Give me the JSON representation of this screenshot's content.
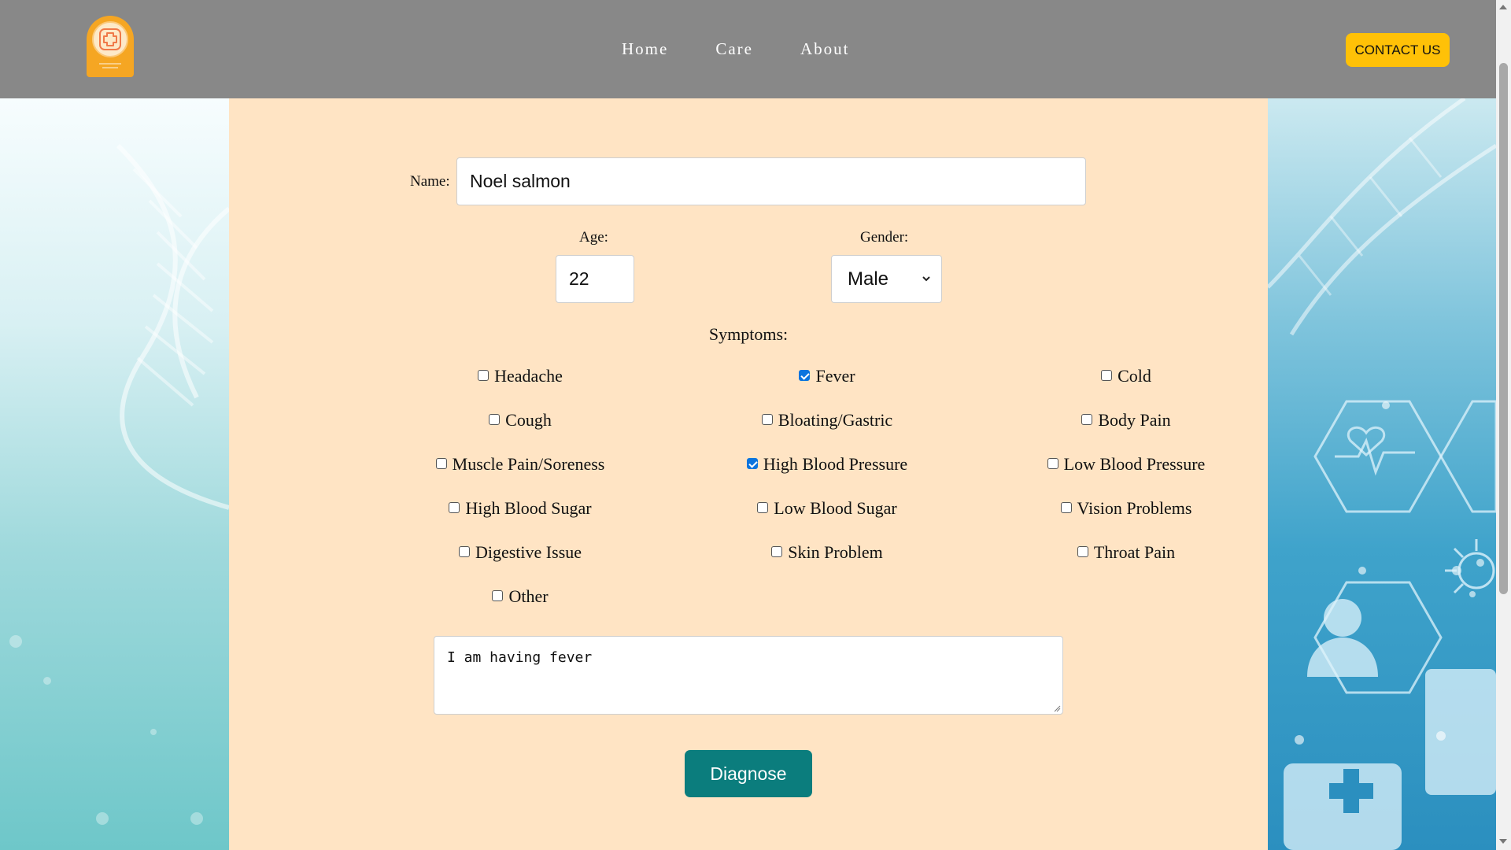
{
  "nav": {
    "links": [
      "Home",
      "Care",
      "About"
    ],
    "contact_label": "CONTACT US"
  },
  "form": {
    "name_label": "Name:",
    "name_value": "Noel salmon",
    "age_label": "Age:",
    "age_value": "22",
    "gender_label": "Gender:",
    "gender_value": "Male",
    "symptoms_label": "Symptoms:",
    "symptoms": [
      {
        "label": "Headache",
        "checked": false
      },
      {
        "label": "Fever",
        "checked": true
      },
      {
        "label": "Cold",
        "checked": false
      },
      {
        "label": "Cough",
        "checked": false
      },
      {
        "label": "Bloating/Gastric",
        "checked": false
      },
      {
        "label": "Body Pain",
        "checked": false
      },
      {
        "label": "Muscle Pain/Soreness",
        "checked": false
      },
      {
        "label": "High Blood Pressure",
        "checked": true
      },
      {
        "label": "Low Blood Pressure",
        "checked": false
      },
      {
        "label": "High Blood Sugar",
        "checked": false
      },
      {
        "label": "Low Blood Sugar",
        "checked": false
      },
      {
        "label": "Vision Problems",
        "checked": false
      },
      {
        "label": "Digestive Issue",
        "checked": false
      },
      {
        "label": "Skin Problem",
        "checked": false
      },
      {
        "label": "Throat Pain",
        "checked": false
      },
      {
        "label": "Other",
        "checked": false
      }
    ],
    "notes_value": "I am having fever",
    "diagnose_label": "Diagnose"
  },
  "colors": {
    "navbar": "#888888",
    "panel": "#ffe4c4",
    "contact_button": "#ffc107",
    "diagnose_button": "#0b7d7d",
    "checkbox_checked": "#0b74de"
  },
  "icons": {
    "logo": "medical-cross-logo-icon"
  }
}
